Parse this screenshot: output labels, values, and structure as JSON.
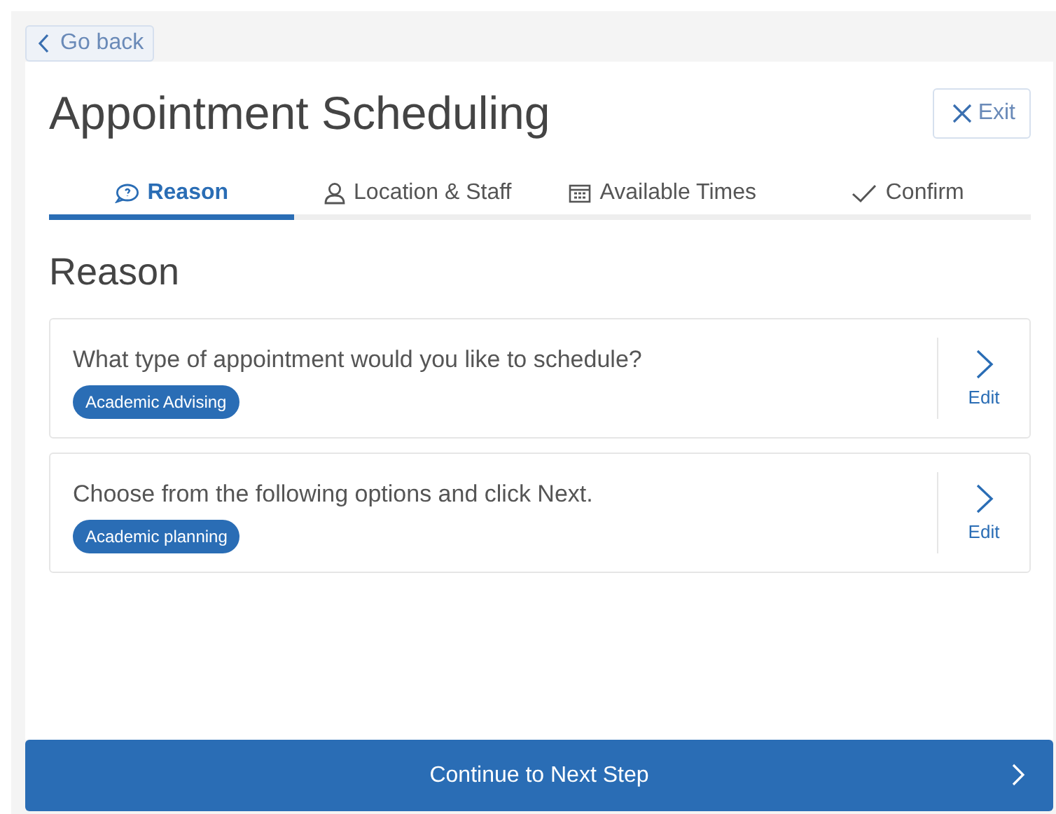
{
  "back_button": {
    "label": "Go back"
  },
  "title": "Appointment Scheduling",
  "exit_button": {
    "label": "Exit"
  },
  "tabs": [
    {
      "label": "Reason",
      "selected": true
    },
    {
      "label": "Location & Staff",
      "selected": false
    },
    {
      "label": "Available Times",
      "selected": false
    },
    {
      "label": "Confirm",
      "selected": false
    }
  ],
  "section_title": "Reason",
  "questions": [
    {
      "question": "What type of appointment would you like to schedule?",
      "answer": "Academic Advising",
      "edit_label": "Edit"
    },
    {
      "question": "Choose from the following options and click Next.",
      "answer": "Academic planning",
      "edit_label": "Edit"
    }
  ],
  "continue_button": {
    "label": "Continue to Next Step"
  }
}
